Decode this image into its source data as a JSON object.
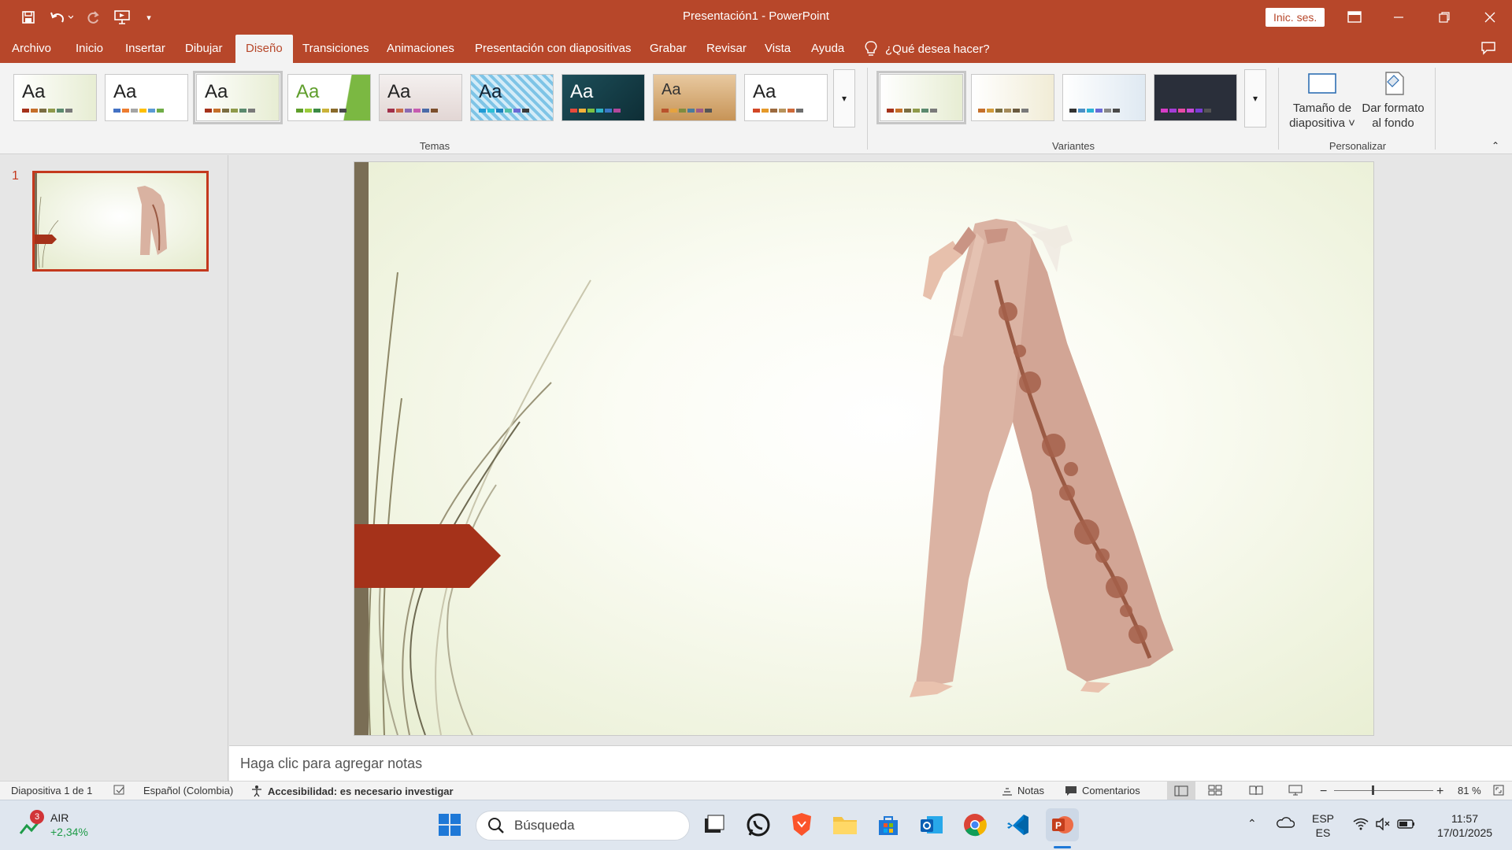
{
  "titlebar": {
    "title": "Presentación1  -  PowerPoint",
    "signin": "Inic. ses.",
    "quick_access": [
      "save-icon",
      "undo-icon",
      "redo-icon",
      "present-icon",
      "customize-icon"
    ]
  },
  "tabs": [
    {
      "label": "Archivo"
    },
    {
      "label": "Inicio"
    },
    {
      "label": "Insertar"
    },
    {
      "label": "Dibujar"
    },
    {
      "label": "Diseño"
    },
    {
      "label": "Transiciones"
    },
    {
      "label": "Animaciones"
    },
    {
      "label": "Presentación con diapositivas"
    },
    {
      "label": "Grabar"
    },
    {
      "label": "Revisar"
    },
    {
      "label": "Vista"
    },
    {
      "label": "Ayuda"
    }
  ],
  "tell_me": "¿Qué desea hacer?",
  "ribbon": {
    "themes_label": "Temas",
    "variants_label": "Variantes",
    "customize_label": "Personalizar",
    "theme_sample": "Aa",
    "slide_size_label": "Tamaño de diapositiva ˅",
    "format_bg_label": "Dar formato al fondo"
  },
  "slides": {
    "current_number": "1"
  },
  "notes_placeholder": "Haga clic para agregar notas",
  "status": {
    "slide_info": "Diapositiva 1 de 1",
    "language": "Español (Colombia)",
    "accessibility": "Accesibilidad: es necesario investigar",
    "notes": "Notas",
    "comments": "Comentarios",
    "zoom": "81 %"
  },
  "taskbar": {
    "widget_name": "AIR",
    "widget_value": "+2,34%",
    "widget_badge": "3",
    "search": "Búsqueda",
    "lang_top": "ESP",
    "lang_bottom": "ES",
    "time": "11:57",
    "date": "17/01/2025"
  },
  "colors": {
    "accent": "#b7472a",
    "ribbon_bg": "#f3f3f3",
    "slide_arrow": "#a5321a",
    "slide_bar": "#7a6e55"
  }
}
